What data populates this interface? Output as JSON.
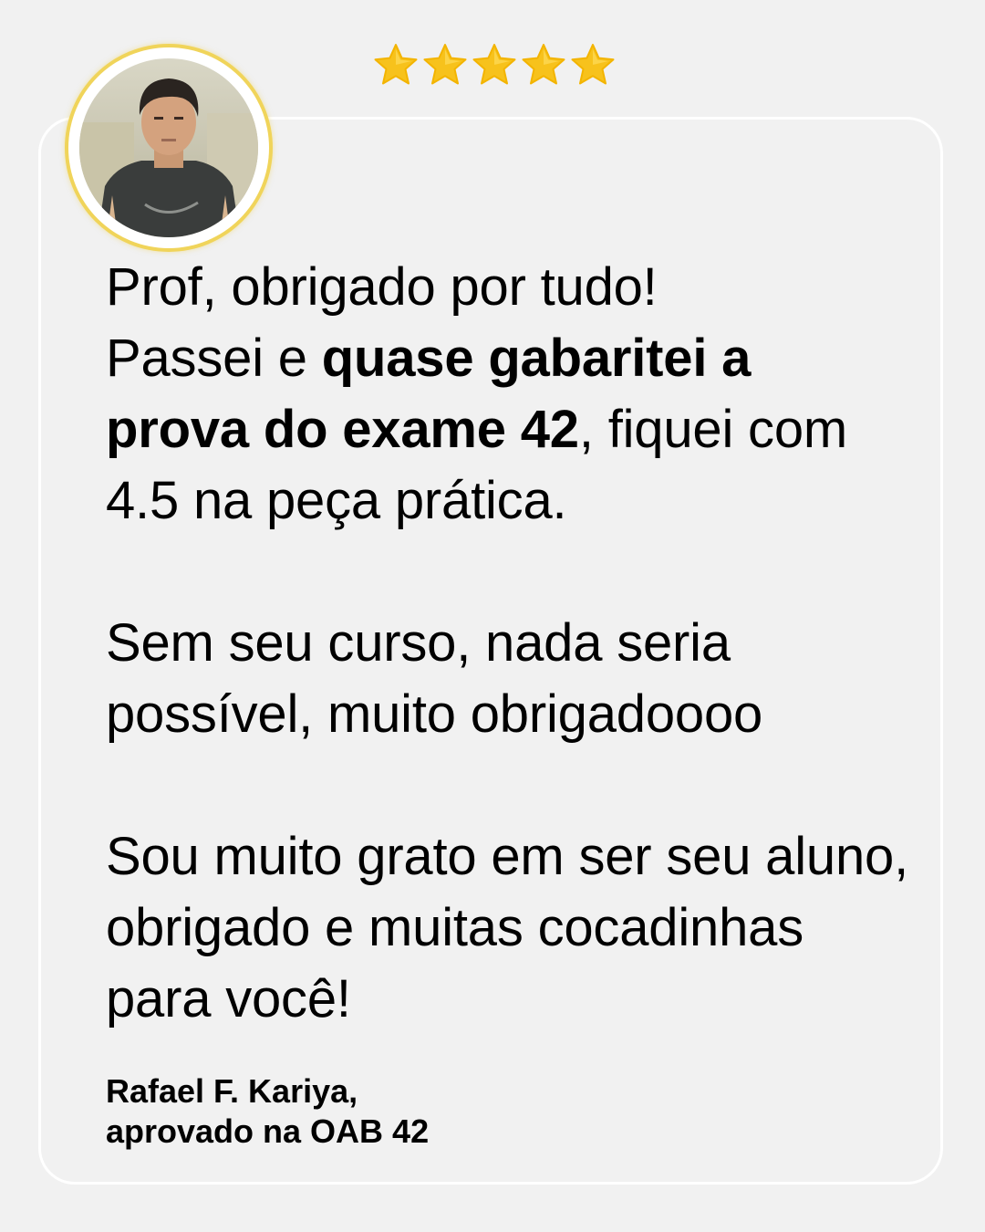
{
  "rating": {
    "stars": 5,
    "max": 5,
    "star_color": "#f7c21c"
  },
  "avatar": {
    "icon": "person-photo",
    "ring_color": "#f0d45a"
  },
  "testimonial": {
    "p1": {
      "line1": "Prof, obrigado por tudo!",
      "pre": "Passei e ",
      "bold": "quase gabaritei a prova do exame 42",
      "post": ", fiquei com 4.5 na peça prática."
    },
    "p2": "Sem seu curso, nada seria possível, muito obrigadoooo",
    "p3": "Sou muito grato em ser seu aluno, obrigado e muitas cocadinhas para você!"
  },
  "author": {
    "name": "Rafael F. Kariya,",
    "status": "aprovado na OAB 42"
  }
}
